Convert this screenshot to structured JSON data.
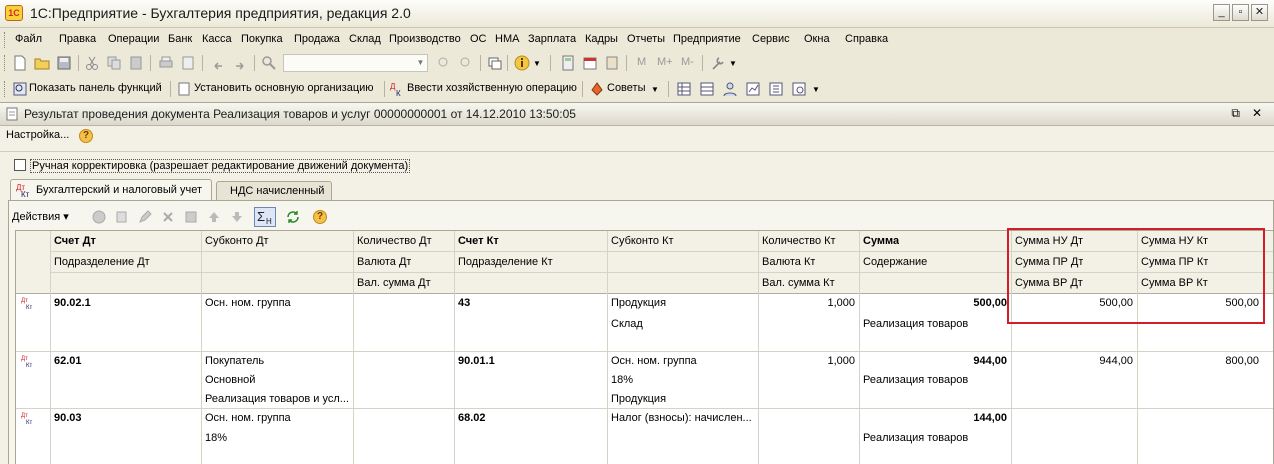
{
  "window": {
    "title": "1С:Предприятие - Бухгалтерия предприятия, редакция 2.0",
    "logo_text": "1С"
  },
  "menu": [
    "Файл",
    "Правка",
    "Операции",
    "Банк",
    "Касса",
    "Покупка",
    "Продажа",
    "Склад",
    "Производство",
    "ОС",
    "НМА",
    "Зарплата",
    "Кадры",
    "Отчеты",
    "Предприятие",
    "Сервис",
    "Окна",
    "Справка"
  ],
  "toolbar2": {
    "show_panel": "Показать панель функций",
    "set_org": "Установить основную организацию",
    "enter_op": "Ввести хозяйственную операцию",
    "tips": "Советы",
    "m_labels": [
      "M",
      "M+",
      "M-"
    ]
  },
  "document": {
    "title": "Результат проведения документа Реализация товаров и услуг 00000000001 от 14.12.2010 13:50:05",
    "settings": "Настройка...",
    "manual_correction": "Ручная корректировка (разрешает редактирование движений документа)",
    "tabs": [
      "Бухгалтерский и налоговый учет",
      "НДС начисленный"
    ],
    "actions": "Действия"
  },
  "grid": {
    "headers": {
      "row1": [
        "Счет Дт",
        "Субконто Дт",
        "Количество Дт",
        "Счет Кт",
        "Субконто Кт",
        "Количество Кт",
        "Сумма",
        "Сумма НУ Дт",
        "Сумма НУ Кт"
      ],
      "row2": [
        "Подразделение Дт",
        "",
        "Валюта Дт",
        "Подразделение Кт",
        "",
        "Валюта Кт",
        "Содержание",
        "Сумма ПР Дт",
        "Сумма ПР Кт"
      ],
      "row3": [
        "",
        "",
        "Вал. сумма Дт",
        "",
        "",
        "Вал. сумма Кт",
        "",
        "Сумма ВР Дт",
        "Сумма ВР Кт"
      ]
    },
    "rows": [
      {
        "icon_dt": "Дт",
        "icon_kt": "Кт",
        "lines": [
          [
            "90.02.1",
            "Осн. ном. группа",
            "",
            "43",
            "Продукция",
            "1,000",
            "500,00",
            "500,00",
            "500,00"
          ],
          [
            "",
            "",
            "",
            "",
            "Склад",
            "",
            "Реализация товаров",
            "",
            ""
          ]
        ]
      },
      {
        "icon_dt": "Дт",
        "icon_kt": "Кт",
        "lines": [
          [
            "62.01",
            "Покупатель",
            "",
            "90.01.1",
            "Осн. ном. группа",
            "1,000",
            "944,00",
            "944,00",
            "800,00"
          ],
          [
            "",
            "Основной",
            "",
            "",
            "18%",
            "",
            "Реализация товаров",
            "",
            ""
          ],
          [
            "",
            "Реализация товаров и усл...",
            "",
            "",
            "Продукция",
            "",
            "",
            "",
            ""
          ]
        ]
      },
      {
        "icon_dt": "Дт",
        "icon_kt": "Кт",
        "lines": [
          [
            "90.03",
            "Осн. ном. группа",
            "",
            "68.02",
            "Налог (взносы): начислен...",
            "",
            "144,00",
            "",
            ""
          ],
          [
            "",
            "18%",
            "",
            "",
            "",
            "",
            "Реализация товаров",
            "",
            ""
          ]
        ]
      }
    ]
  },
  "colors": {
    "highlight_box": "#d01e2a",
    "background": "#ece9d8"
  }
}
